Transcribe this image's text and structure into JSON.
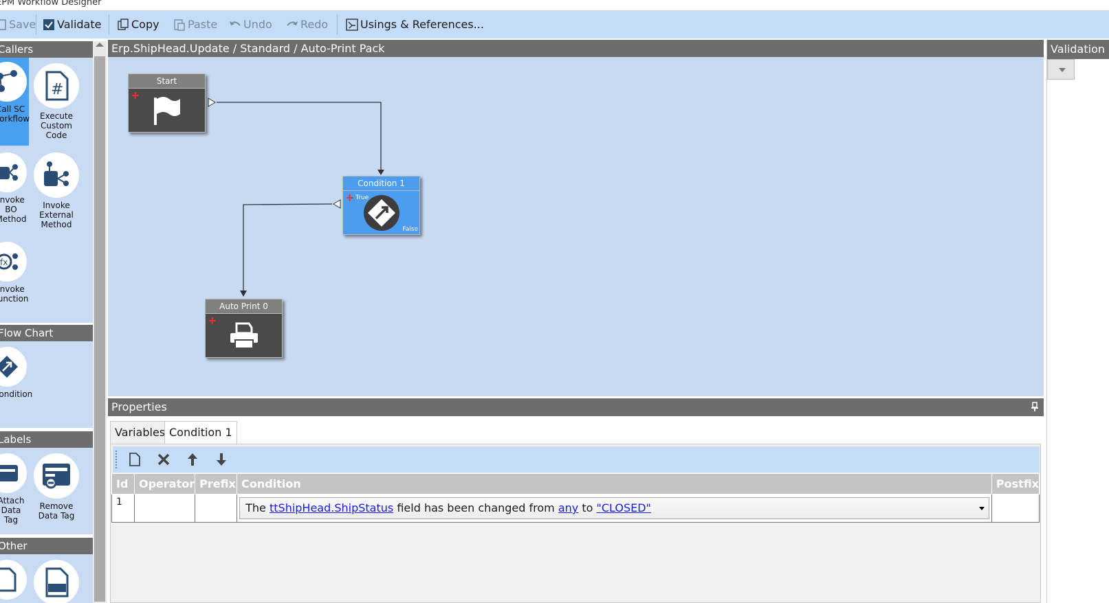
{
  "window": {
    "title": "EPM Workflow Designer"
  },
  "toolbar": {
    "save": "Save",
    "validate": "Validate",
    "copy": "Copy",
    "paste": "Paste",
    "undo": "Undo",
    "redo": "Redo",
    "usings": "Usings & References..."
  },
  "toolbox": {
    "callers_header": "Callers",
    "callers": [
      {
        "label": "Call SC Workflow",
        "icon": "workflow-icon",
        "selected": true
      },
      {
        "label": "Execute Custom Code",
        "icon": "hash-file-icon"
      },
      {
        "label": "Invoke BO Method",
        "icon": "bo-method-icon"
      },
      {
        "label": "Invoke External Method",
        "icon": "external-method-icon"
      },
      {
        "label": "Invoke Function",
        "icon": "function-icon"
      }
    ],
    "flowchart_header": "Flow Chart",
    "flowchart": [
      {
        "label": "Condition",
        "icon": "condition-icon"
      }
    ],
    "labels_header": "Labels",
    "labels": [
      {
        "label": "Attach Data Tag",
        "icon": "attach-tag-icon"
      },
      {
        "label": "Remove Data Tag",
        "icon": "remove-tag-icon"
      }
    ],
    "other_header": "Other"
  },
  "canvas": {
    "breadcrumb": "Erp.ShipHead.Update / Standard / Auto-Print Pack",
    "nodes": {
      "start": {
        "title": "Start",
        "icon": "flag-icon"
      },
      "condition": {
        "title": "Condition 1",
        "true_label": "True",
        "false_label": "False",
        "icon": "condition-icon"
      },
      "autoprint": {
        "title": "Auto Print 0",
        "icon": "printer-icon"
      }
    }
  },
  "right_panel": {
    "header": "Validation"
  },
  "properties": {
    "header": "Properties",
    "tabs": [
      "Variables",
      "Condition 1"
    ],
    "active_tab": "Condition 1",
    "columns": [
      "Id",
      "Operator",
      "Prefix",
      "Condition",
      "Postfix"
    ],
    "rows": [
      {
        "id": "1",
        "operator": "",
        "prefix": "",
        "condition": {
          "t1": "The",
          "field": "ttShipHead.ShipStatus",
          "t2": "field has been changed from",
          "from": "any",
          "t3": "to",
          "to": "\"CLOSED\""
        },
        "postfix": ""
      }
    ]
  },
  "colors": {
    "toolbar_bg": "#c4dcf7",
    "header_gray": "#6d6d6d",
    "canvas_bg": "#c8daf1",
    "node_dark": "#4a4a4a",
    "node_blue": "#4c9cf2",
    "link_blue": "#1a1aee"
  }
}
